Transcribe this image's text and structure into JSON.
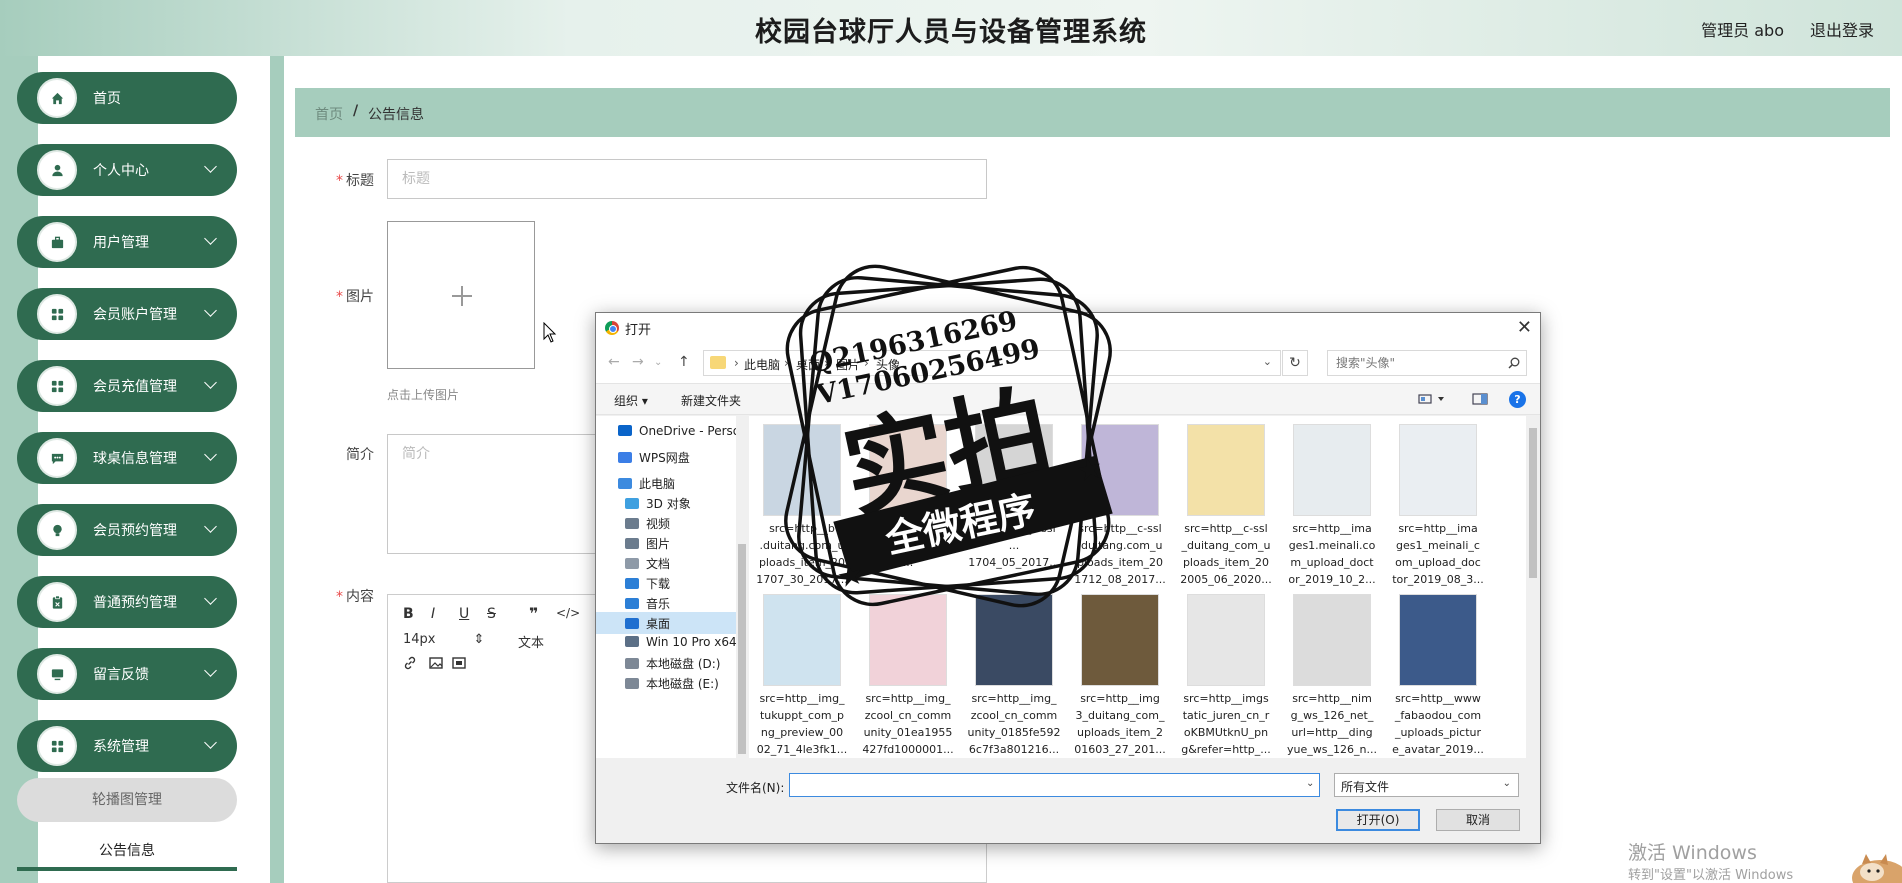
{
  "header": {
    "title": "校园台球厅人员与设备管理系统",
    "admin": "管理员 abo",
    "logout": "退出登录"
  },
  "sidebar": {
    "items": [
      {
        "label": "首页",
        "icon": "home-icon",
        "expandable": false
      },
      {
        "label": "个人中心",
        "icon": "user-icon",
        "expandable": true
      },
      {
        "label": "用户管理",
        "icon": "briefcase-icon",
        "expandable": true
      },
      {
        "label": "会员账户管理",
        "icon": "grid-icon",
        "expandable": true
      },
      {
        "label": "会员充值管理",
        "icon": "grid-icon",
        "expandable": true
      },
      {
        "label": "球桌信息管理",
        "icon": "chat-icon",
        "expandable": true
      },
      {
        "label": "会员预约管理",
        "icon": "bulb-icon",
        "expandable": true
      },
      {
        "label": "普通预约管理",
        "icon": "clipboard-icon",
        "expandable": true
      },
      {
        "label": "留言反馈",
        "icon": "monitor-icon",
        "expandable": true
      },
      {
        "label": "系统管理",
        "icon": "grid-icon",
        "expandable": true
      }
    ],
    "submenu": [
      {
        "label": "轮播图管理"
      },
      {
        "label": "公告信息"
      }
    ]
  },
  "breadcrumb": {
    "home": "首页",
    "separator": "/",
    "current": "公告信息"
  },
  "form": {
    "title_label": "标题",
    "title_placeholder": "标题",
    "image_label": "图片",
    "upload_hint": "点击上传图片",
    "intro_label": "简介",
    "intro_placeholder": "简介",
    "content_label": "内容",
    "editor": {
      "font_size": "14px",
      "text_style": "文本"
    }
  },
  "dialog": {
    "title": "打开",
    "path": [
      "此电脑",
      "桌面",
      "图片",
      "头像"
    ],
    "search_placeholder": "搜索\"头像\"",
    "toolbar": {
      "organize": "组织 ▾",
      "new_folder": "新建文件夹"
    },
    "nav_items": [
      {
        "label": "OneDrive - Perso",
        "color": "#0a64c9"
      },
      {
        "label": "WPS网盘",
        "color": "#3b7ee6"
      },
      {
        "label": "此电脑",
        "color": "#3c8adf"
      },
      {
        "label": "3D 对象",
        "color": "#3fa0e0"
      },
      {
        "label": "视频",
        "color": "#6b7c8e"
      },
      {
        "label": "图片",
        "color": "#6b7c8e"
      },
      {
        "label": "文档",
        "color": "#8e9aa8"
      },
      {
        "label": "下载",
        "color": "#2c7fd6"
      },
      {
        "label": "音乐",
        "color": "#2c7fd6"
      },
      {
        "label": "桌面",
        "color": "#1f6fd0"
      },
      {
        "label": "Win 10 Pro x64",
        "color": "#5b6f86"
      },
      {
        "label": "本地磁盘 (D:)",
        "color": "#7d8896"
      },
      {
        "label": "本地磁盘 (E:)",
        "color": "#7d8896"
      }
    ],
    "files": [
      {
        "name": "src=http__b\n.duitang.com_u\nploads_item_20\n1707_30_2017...",
        "thumb": "#c9d6e2"
      },
      {
        "name": "src=http__b-ssl\n.duit...\n...",
        "thumb": "#e9d6cf"
      },
      {
        "name": "src=http__c-ssl\n...\n1704_05_2017...",
        "thumb": "#d5d5d5"
      },
      {
        "name": "src=http__c-ssl\n.duitang.com_u\nploads_item_20\n1712_08_2017...",
        "thumb": "#bfb6d8"
      },
      {
        "name": "src=http__c-ssl\n_duitang_com_u\nploads_item_20\n2005_06_2020...",
        "thumb": "#f3e1a8"
      },
      {
        "name": "src=http__ima\nges1.meinali.co\nm_upload_doct\nor_2019_10_2...",
        "thumb": "#e7ecef"
      },
      {
        "name": "src=http__ima\nges1_meinali_c\nom_upload_doc\ntor_2019_08_3...",
        "thumb": "#eaeef2"
      },
      {
        "name": "src=http__img_\ntukuppt_com_p\nng_preview_00\n02_71_4le3fk1...",
        "thumb": "#cfe3ef"
      },
      {
        "name": "src=http__img_\nzcool_cn_comm\nunity_01ea1955\n427fd1000001...",
        "thumb": "#f1d2d9"
      },
      {
        "name": "src=http__img_\nzcool_cn_comm\nunity_0185fe592\n6c7f3a801216...",
        "thumb": "#3a4a63"
      },
      {
        "name": "src=http__img\n3_duitang_com_\nuploads_item_2\n01603_27_201...",
        "thumb": "#6e5a3c"
      },
      {
        "name": "src=http__imgs\ntatic_juren_cn_r\noKBMUtknU_pn\ng&refer=http_...",
        "thumb": "#e6e6e6"
      },
      {
        "name": "src=http__nim\ng_ws_126_net_\nurl=http__ding\nyue_ws_126_n...",
        "thumb": "#dcdcdc"
      },
      {
        "name": "src=http__www\n_fabaodou_com\n_uploads_pictur\ne_avatar_2019...",
        "thumb": "#3c5a8a"
      }
    ],
    "filename_label": "文件名(N):",
    "filter": "所有文件",
    "open_button": "打开(O)",
    "cancel_button": "取消"
  },
  "watermark": {
    "qq": "Q2196316269",
    "vx": "V17060256499",
    "big": "实拍",
    "ribbon": "全微程序"
  },
  "windows_notice": {
    "title": "激活 Windows",
    "subtitle": "转到\"设置\"以激活 Windows"
  }
}
